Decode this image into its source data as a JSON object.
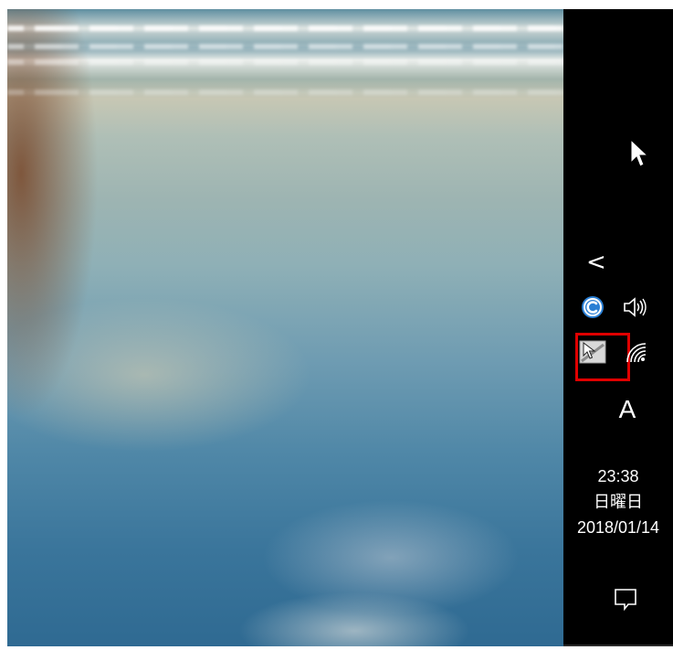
{
  "taskbar": {
    "show_hidden_icons": "<",
    "ime_indicator": "A",
    "clock": {
      "time": "23:38",
      "weekday": "日曜日",
      "date": "2018/01/14"
    }
  },
  "icons": {
    "cursor": "mouse-pointer-icon",
    "app": "c-app-icon",
    "volume": "speaker-icon",
    "tablet": "pen-tablet-icon",
    "network": "wifi-icon",
    "notifications": "action-center-icon"
  },
  "colors": {
    "taskbar": "#000000",
    "highlight": "#e00000",
    "app_icon": "#2a7fd4"
  }
}
